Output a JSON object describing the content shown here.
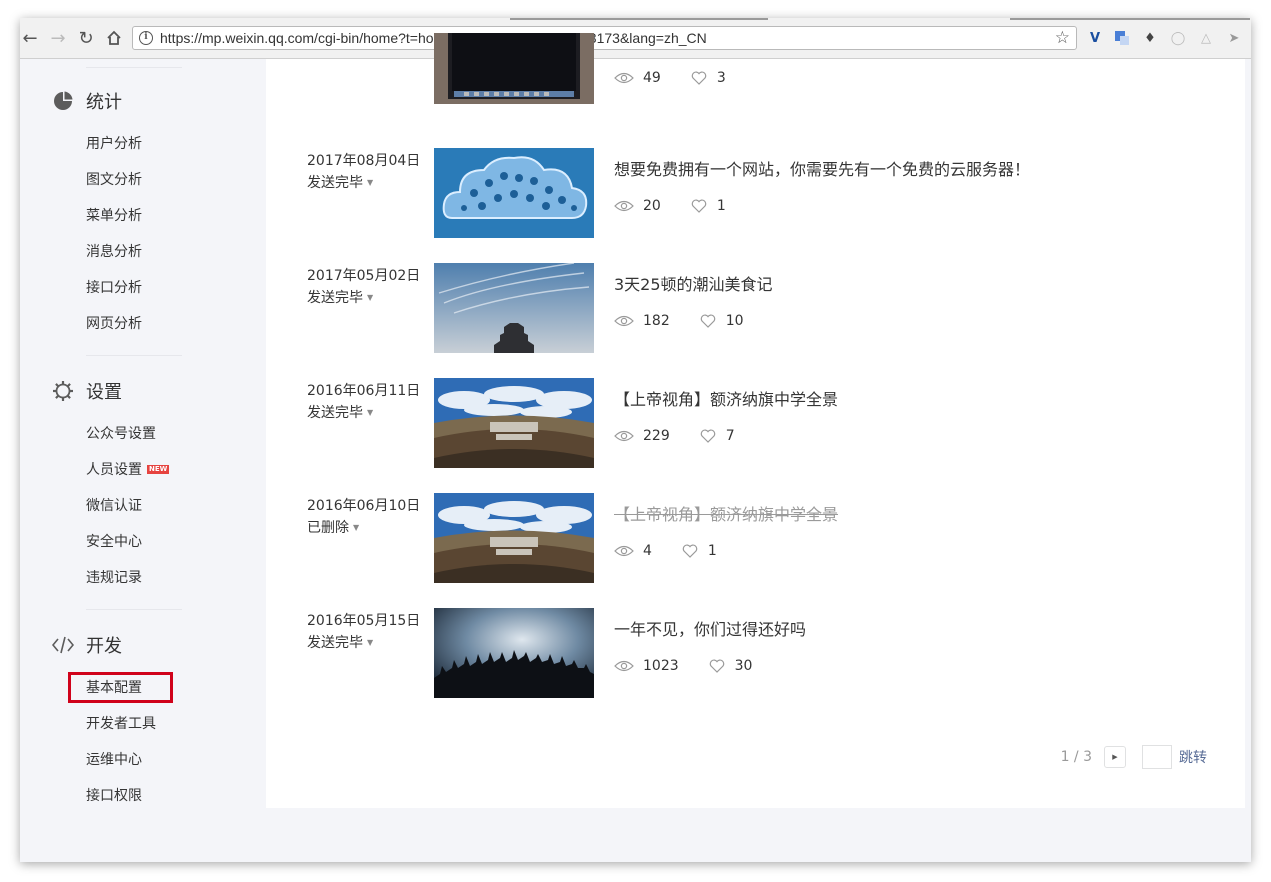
{
  "browser": {
    "url": "https://mp.weixin.qq.com/cgi-bin/home?t=home/index&token=1569403173&lang=zh_CN",
    "back_icon": "arrow-left-icon",
    "forward_icon": "arrow-right-icon",
    "reload_icon": "reload-icon",
    "home_icon": "home-icon",
    "bookmark_icon": "star-icon"
  },
  "sidebar": {
    "sections": [
      {
        "title": "统计",
        "icon": "pie-chart-icon",
        "items": [
          "用户分析",
          "图文分析",
          "菜单分析",
          "消息分析",
          "接口分析",
          "网页分析"
        ]
      },
      {
        "title": "设置",
        "icon": "gear-icon",
        "items": [
          "公众号设置",
          "人员设置",
          "微信认证",
          "安全中心",
          "违规记录"
        ],
        "badge": "NEW"
      },
      {
        "title": "开发",
        "icon": "code-icon",
        "items": [
          "基本配置",
          "开发者工具",
          "运维中心",
          "接口权限"
        ]
      }
    ]
  },
  "articles": [
    {
      "date": "",
      "status": "",
      "title": "",
      "views": "49",
      "likes": "3"
    },
    {
      "date": "2017年08月04日",
      "status": "发送完毕",
      "title": "想要免费拥有一个网站，你需要先有一个免费的云服务器！",
      "views": "20",
      "likes": "1"
    },
    {
      "date": "2017年05月02日",
      "status": "发送完毕",
      "title": "3天25顿的潮汕美食记",
      "views": "182",
      "likes": "10"
    },
    {
      "date": "2016年06月11日",
      "status": "发送完毕",
      "title": "【上帝视角】额济纳旗中学全景",
      "views": "229",
      "likes": "7"
    },
    {
      "date": "2016年06月10日",
      "status": "已删除",
      "title": "【上帝视角】额济纳旗中学全景",
      "views": "4",
      "likes": "1"
    },
    {
      "date": "2016年05月15日",
      "status": "发送完毕",
      "title": "一年不见，你们过得还好吗",
      "views": "1023",
      "likes": "30"
    }
  ],
  "pager": {
    "current": "1 / 3",
    "jump_label": "跳转"
  },
  "colors": {
    "accent_link": "#576b95",
    "highlight_border": "#d0021b",
    "panel_bg": "#ffffff",
    "page_bg": "#f4f5f9"
  }
}
